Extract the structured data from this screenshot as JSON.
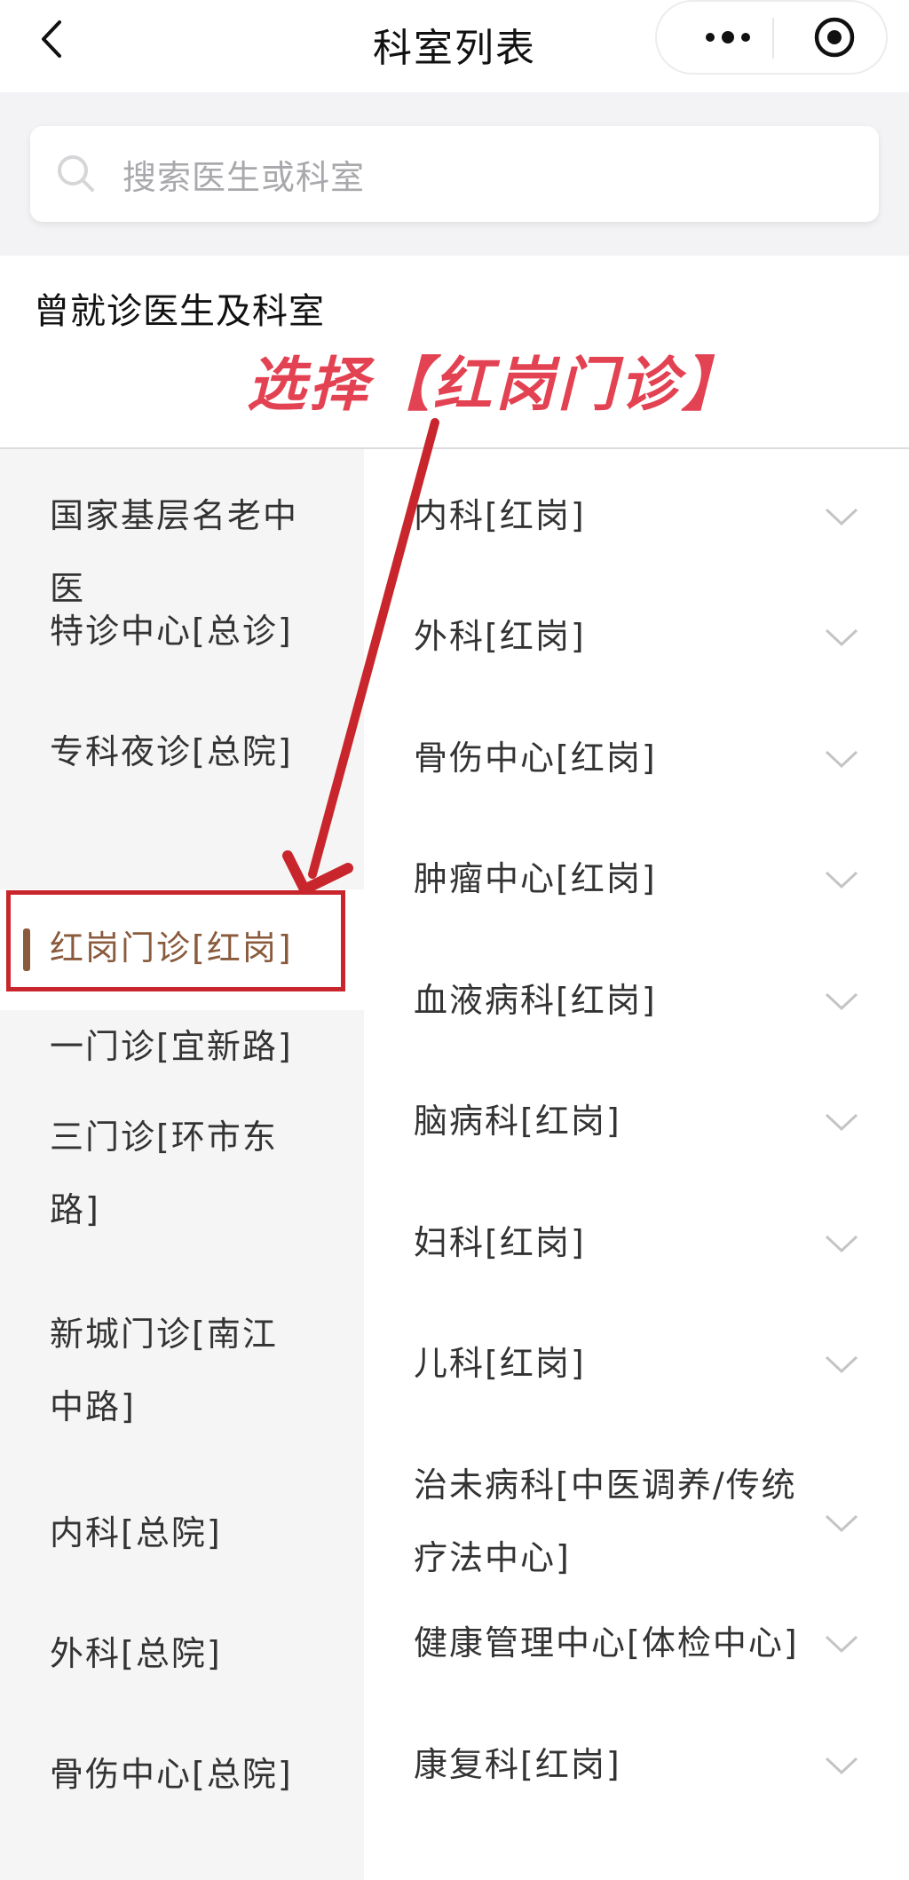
{
  "header": {
    "title": "科室列表",
    "back_icon": "chevron-left-icon",
    "more_icon": "more-dots-icon",
    "close_icon": "target-circle-icon"
  },
  "search": {
    "placeholder": "搜索医生或科室",
    "icon": "search-icon"
  },
  "history": {
    "title": "曾就诊医生及科室"
  },
  "annotation": {
    "text": "选择【红岗门诊】",
    "color": "#e34252",
    "arrow_color": "#c8262c"
  },
  "left_menu": {
    "active_index": 3,
    "items": [
      {
        "label_line1": "国家基层名老中",
        "label_line2": "医"
      },
      {
        "label_line1": "特诊中心[总诊]",
        "label_line2": ""
      },
      {
        "label_line1": "专科夜诊[总院]",
        "label_line2": ""
      },
      {
        "label_line1": "红岗门诊[红岗]",
        "label_line2": ""
      },
      {
        "label_line1": "一门诊[宜新路]",
        "label_line2": ""
      },
      {
        "label_line1": "三门诊[环市东",
        "label_line2": "路]"
      },
      {
        "label_line1": "新城门诊[南江",
        "label_line2": "中路]"
      },
      {
        "label_line1": "内科[总院]",
        "label_line2": ""
      },
      {
        "label_line1": "外科[总院]",
        "label_line2": ""
      },
      {
        "label_line1": "骨伤中心[总院]",
        "label_line2": ""
      }
    ]
  },
  "right_list": {
    "items": [
      {
        "label_line1": "内科[红岗]",
        "label_line2": ""
      },
      {
        "label_line1": "外科[红岗]",
        "label_line2": ""
      },
      {
        "label_line1": "骨伤中心[红岗]",
        "label_line2": ""
      },
      {
        "label_line1": "肿瘤中心[红岗]",
        "label_line2": ""
      },
      {
        "label_line1": "血液病科[红岗]",
        "label_line2": ""
      },
      {
        "label_line1": "脑病科[红岗]",
        "label_line2": ""
      },
      {
        "label_line1": "妇科[红岗]",
        "label_line2": ""
      },
      {
        "label_line1": "儿科[红岗]",
        "label_line2": ""
      },
      {
        "label_line1": "治未病科[中医调养/传统",
        "label_line2": "疗法中心]"
      },
      {
        "label_line1": "健康管理中心[体检中心]",
        "label_line2": ""
      },
      {
        "label_line1": "康复科[红岗]",
        "label_line2": ""
      }
    ]
  },
  "colors": {
    "active_text": "#8a5a3c",
    "left_bg": "#f5f5f5",
    "search_bg": "#f3f3f5"
  }
}
